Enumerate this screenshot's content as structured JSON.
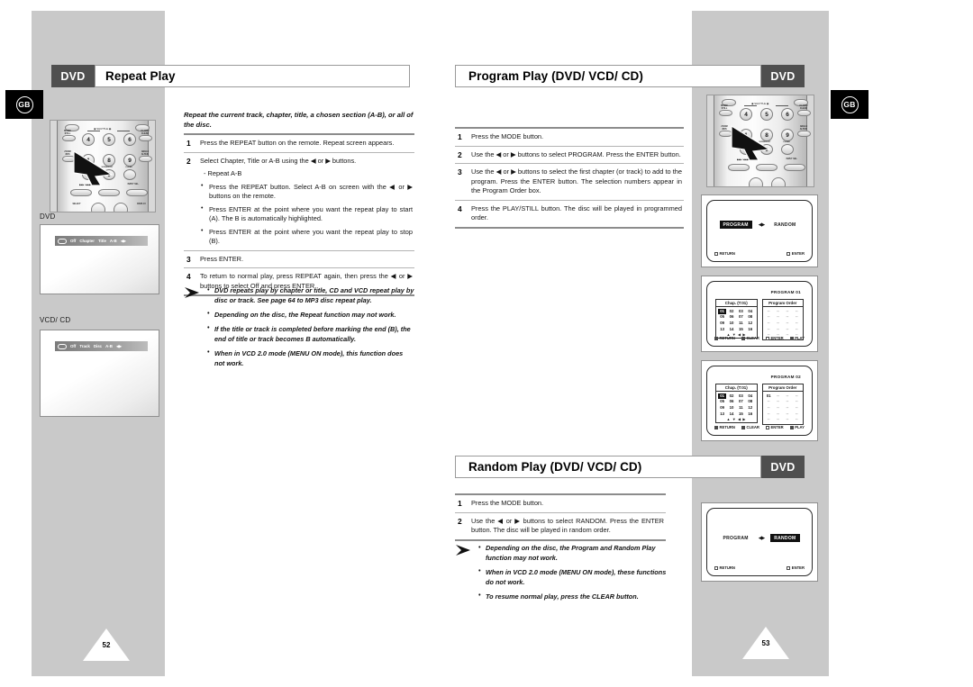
{
  "language_badge": "GB",
  "pages": {
    "left": "52",
    "right": "53"
  },
  "sections": {
    "repeat": {
      "badge": "DVD",
      "title": "Repeat Play",
      "intro": "Repeat the current track, chapter, title, a chosen section (A-B), or all of the disc.",
      "steps": [
        {
          "num": "1",
          "text": "Press the REPEAT button on the remote. Repeat screen appears."
        },
        {
          "num": "2",
          "text": "Select Chapter, Title or A-B using the ◀ or ▶ buttons.",
          "dash": "- Repeat A-B",
          "bullets": [
            "Press the REPEAT button. Select A-B on screen with the ◀ or ▶ buttons on the remote.",
            "Press ENTER at the point where you want the repeat play to start (A). The B is automatically highlighted.",
            "Press ENTER at the point where you want the repeat play to stop (B)."
          ]
        },
        {
          "num": "3",
          "text": "Press ENTER."
        },
        {
          "num": "4",
          "text": "To return to normal play, press REPEAT again, then press the ◀ or ▶ buttons to select Off and press ENTER."
        }
      ],
      "notes": [
        "DVD repeats play by chapter or title, CD and VCD repeat play by disc or track. See page 64 to MP3 disc repeat play.",
        "Depending on the disc, the Repeat function may not work.",
        "If the title or track is completed before marking the end (B), the end of title or track becomes B automatically.",
        "When in VCD 2.0 mode (MENU ON mode), this function does not work."
      ],
      "mockups": [
        {
          "label": "DVD",
          "osd_items": [
            "Off",
            "Chapter",
            "Title",
            "A-B"
          ],
          "arrows": "◀▶"
        },
        {
          "label": "VCD/ CD",
          "osd_items": [
            "Off",
            "Track",
            "Disc",
            "A-B"
          ],
          "arrows": "◀▶"
        }
      ]
    },
    "program": {
      "badge": "DVD",
      "title": "Program Play (DVD/ VCD/ CD)",
      "steps": [
        {
          "num": "1",
          "text": "Press the MODE button."
        },
        {
          "num": "2",
          "text": "Use the ◀ or ▶ buttons to select PROGRAM. Press the ENTER button."
        },
        {
          "num": "3",
          "text": "Use the ◀ or ▶ buttons to select the first chapter (or track) to add to the program. Press the ENTER button. The selection numbers appear in the Program Order box."
        },
        {
          "num": "4",
          "text": "Press the PLAY/STILL button. The disc will be played in programmed order."
        }
      ],
      "mode_screen": {
        "left_chip": "PROGRAM",
        "right_chip": "RANDOM",
        "selected": "PROGRAM",
        "arrows": "◀▶",
        "footer": [
          {
            "key": "hollow",
            "label": "RETURN"
          },
          {
            "key": "hollow",
            "label": "ENTER"
          }
        ]
      },
      "program_screens": [
        {
          "title": "PROGRAM 01",
          "chap_header": "Chap. (T:01)",
          "order_header": "Program Order",
          "chapters": [
            "01",
            "02",
            "03",
            "04",
            "05",
            "06",
            "07",
            "08",
            "09",
            "10",
            "11",
            "12",
            "13",
            "14",
            "15",
            "16"
          ],
          "selected_chapter": "01",
          "nav": "▲ ▼  ◀ ▶",
          "order_values": [
            "--",
            "--",
            "--",
            "--",
            "--",
            "--",
            "--",
            "--",
            "--",
            "--",
            "--",
            "--",
            "--",
            "--",
            "--",
            "--",
            "--",
            "--",
            "--",
            "--"
          ],
          "footer": [
            {
              "key": "solid",
              "label": "RETURN"
            },
            {
              "key": "solid",
              "label": "CLEAR"
            },
            {
              "key": "hollow",
              "label": "ENTER"
            },
            {
              "key": "solid",
              "label": "PLAY"
            }
          ]
        },
        {
          "title": "PROGRAM 02",
          "chap_header": "Chap. (T:01)",
          "order_header": "Program Order",
          "chapters": [
            "01",
            "02",
            "03",
            "04",
            "05",
            "06",
            "07",
            "08",
            "09",
            "10",
            "11",
            "12",
            "13",
            "14",
            "15",
            "16"
          ],
          "selected_chapter": "01",
          "nav": "▲ ▼  ◀ ▶",
          "order_values": [
            "01",
            "--",
            "--",
            "--",
            "--",
            "--",
            "--",
            "--",
            "--",
            "--",
            "--",
            "--",
            "--",
            "--",
            "--",
            "--",
            "--",
            "--",
            "--",
            "--"
          ],
          "footer": [
            {
              "key": "solid",
              "label": "RETURN"
            },
            {
              "key": "solid",
              "label": "CLEAR"
            },
            {
              "key": "hollow",
              "label": "ENTER"
            },
            {
              "key": "solid",
              "label": "PLAY"
            }
          ]
        }
      ]
    },
    "random": {
      "badge": "DVD",
      "title": "Random Play (DVD/ VCD/ CD)",
      "steps": [
        {
          "num": "1",
          "text": "Press the MODE button."
        },
        {
          "num": "2",
          "text": "Use the ◀ or ▶ buttons to select RANDOM. Press the ENTER button. The disc will be played in random order."
        }
      ],
      "notes": [
        "Depending on the disc, the Program and Random Play function may not work.",
        "When in VCD 2.0 mode (MENU ON mode), these functions do not work.",
        "To resume normal play, press the CLEAR button."
      ],
      "mode_screen": {
        "left_chip": "PROGRAM",
        "right_chip": "RANDOM",
        "selected": "RANDOM",
        "arrows": "◀▶",
        "footer": [
          {
            "key": "hollow",
            "label": "RETURN"
          },
          {
            "key": "hollow",
            "label": "ENTER"
          }
        ]
      }
    }
  },
  "remote": {
    "numbers": [
      "4",
      "5",
      "6",
      "1",
      "8",
      "9",
      "0"
    ],
    "labels": [
      "AUDIO",
      "REPEAT",
      "REPEAT A-B",
      "ANGLE",
      "SUBTITLE",
      "MODE/ STILL",
      "ZOOM",
      "CLOCK/ CLEAR",
      "3D SOUND",
      "SCREEN FIT",
      "CLEAR",
      "TITLE/ ALTER.",
      "MENU",
      "INPUT SEL.",
      "SELECT",
      "DISPLAY"
    ],
    "shuttle": "SHUTTLE"
  },
  "colors": {
    "badge_gray": "#4f4f4f",
    "page_gray": "#c9c9c9",
    "rule": "#8c8c8c",
    "osd_dark": "#111111"
  }
}
